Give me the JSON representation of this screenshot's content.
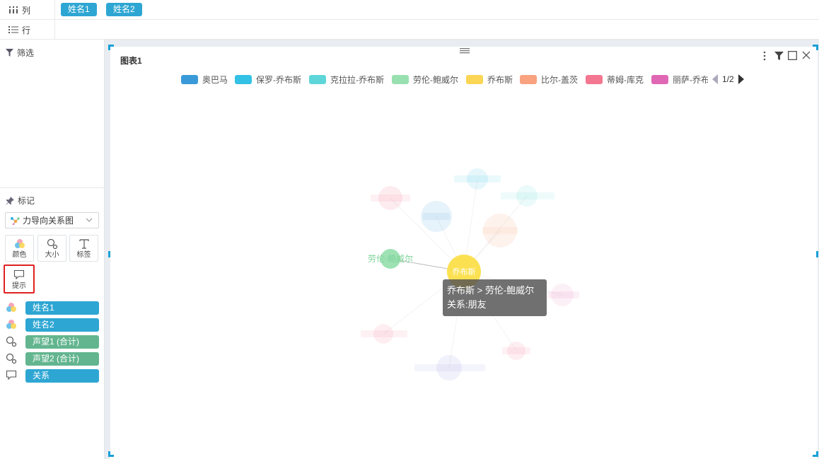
{
  "shelves": {
    "columns": {
      "label": "列",
      "fields": [
        "姓名1",
        "姓名2"
      ]
    },
    "rows": {
      "label": "行"
    }
  },
  "filter": {
    "title": "筛选"
  },
  "marks": {
    "title": "标记",
    "chart_type": "力导向关系图",
    "buttons": [
      {
        "label": "颜色",
        "icon": "color-icon"
      },
      {
        "label": "大小",
        "icon": "size-icon"
      },
      {
        "label": "标签",
        "icon": "text-label-icon"
      },
      {
        "label": "提示",
        "icon": "tooltip-icon"
      }
    ],
    "fields": [
      {
        "icon": "color-icon",
        "label": "姓名1",
        "kind": "dimension"
      },
      {
        "icon": "color-icon",
        "label": "姓名2",
        "kind": "dimension"
      },
      {
        "icon": "size-icon",
        "label": "声望1 (合计)",
        "kind": "measure"
      },
      {
        "icon": "size-icon",
        "label": "声望2 (合计)",
        "kind": "measure"
      },
      {
        "icon": "tooltip-icon",
        "label": "关系",
        "kind": "dimension"
      }
    ]
  },
  "chart": {
    "title": "图表1",
    "page": "1/2",
    "legend": [
      {
        "name": "奥巴马",
        "color": "#3a9ad9"
      },
      {
        "name": "保罗-乔布斯",
        "color": "#33c1e6"
      },
      {
        "name": "克拉拉-乔布斯",
        "color": "#5ed6d9"
      },
      {
        "name": "劳伦-鲍威尔",
        "color": "#99e0b0"
      },
      {
        "name": "乔布斯",
        "color": "#fbd554"
      },
      {
        "name": "比尔-盖茨",
        "color": "#f8a27f"
      },
      {
        "name": "蒂姆-库克",
        "color": "#f47791"
      },
      {
        "name": "丽萨-乔布",
        "color": "#e067b4"
      }
    ],
    "tooltip": {
      "line1": "乔布斯 > 劳伦-鲍威尔",
      "line2": "关系:朋友"
    },
    "node_labels": {
      "jobs": "乔布斯",
      "lauren": "劳伦-鲍威尔"
    }
  },
  "chart_data": {
    "type": "force-directed-graph",
    "nodes": [
      "乔布斯",
      "劳伦-鲍威尔",
      "奥巴马",
      "保罗-乔布斯",
      "克拉拉-乔布斯",
      "比尔-盖茨",
      "蒂姆-库克",
      "丽萨-乔布"
    ],
    "edges": [
      {
        "source": "乔布斯",
        "target": "劳伦-鲍威尔",
        "relation": "朋友"
      }
    ]
  },
  "colors": {
    "accent": "#2ea6d3",
    "measure": "#63b58f",
    "selection": "#e02020"
  }
}
